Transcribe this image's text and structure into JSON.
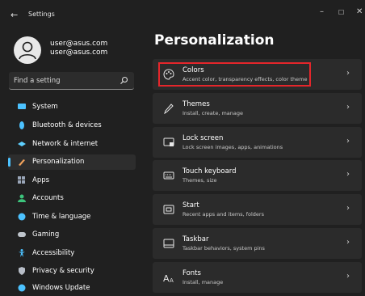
{
  "window": {
    "title": "Settings"
  },
  "user": {
    "name": "user@asus.com",
    "email": "user@asus.com"
  },
  "search": {
    "placeholder": "Find a setting"
  },
  "sidebar": {
    "items": [
      {
        "label": "System",
        "icon": "monitor-icon",
        "color": "#4cc2ff"
      },
      {
        "label": "Bluetooth & devices",
        "icon": "bluetooth-icon",
        "color": "#4cc2ff"
      },
      {
        "label": "Network & internet",
        "icon": "wifi-icon",
        "color": "#5fd0ff"
      },
      {
        "label": "Personalization",
        "icon": "brush-icon",
        "color": "#f2a35c",
        "active": true
      },
      {
        "label": "Apps",
        "icon": "apps-icon",
        "color": "#9aa6b8"
      },
      {
        "label": "Accounts",
        "icon": "person-icon",
        "color": "#3cc47c"
      },
      {
        "label": "Time & language",
        "icon": "globe-clock-icon",
        "color": "#4cc2ff"
      },
      {
        "label": "Gaming",
        "icon": "gamepad-icon",
        "color": "#bfc5cc"
      },
      {
        "label": "Accessibility",
        "icon": "accessibility-icon",
        "color": "#4cc2ff"
      },
      {
        "label": "Privacy & security",
        "icon": "shield-icon",
        "color": "#b8bec8"
      },
      {
        "label": "Windows Update",
        "icon": "update-icon",
        "color": "#4cc2ff"
      }
    ]
  },
  "main": {
    "title": "Personalization",
    "cards": [
      {
        "title": "Colors",
        "subtitle": "Accent color, transparency effects, color theme",
        "icon": "palette-icon"
      },
      {
        "title": "Themes",
        "subtitle": "Install, create, manage",
        "icon": "brush-icon"
      },
      {
        "title": "Lock screen",
        "subtitle": "Lock screen images, apps, animations",
        "icon": "lock-screen-icon"
      },
      {
        "title": "Touch keyboard",
        "subtitle": "Themes, size",
        "icon": "keyboard-icon"
      },
      {
        "title": "Start",
        "subtitle": "Recent apps and items, folders",
        "icon": "start-icon"
      },
      {
        "title": "Taskbar",
        "subtitle": "Taskbar behaviors, system pins",
        "icon": "taskbar-icon"
      },
      {
        "title": "Fonts",
        "subtitle": "Install, manage",
        "icon": "fonts-icon"
      }
    ],
    "highlight_color": "#e5262b"
  }
}
